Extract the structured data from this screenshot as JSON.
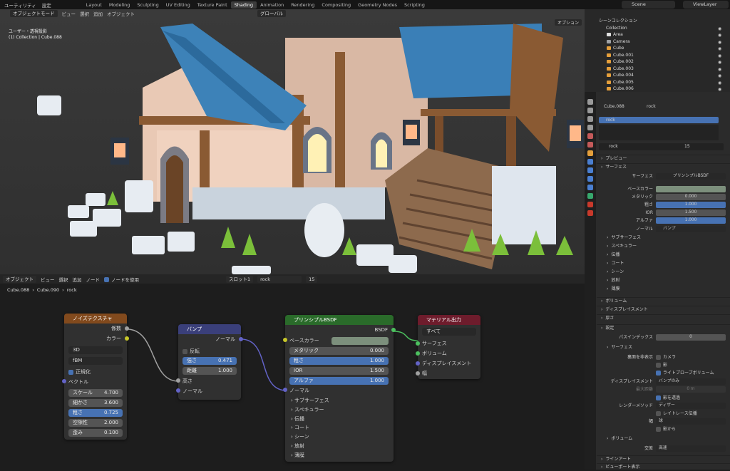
{
  "topbar": {
    "menus": [
      "ユーティリティ",
      "設定"
    ],
    "workspaces": [
      "Layout",
      "Modeling",
      "Sculpting",
      "UV Editing",
      "Texture Paint",
      "Shading",
      "Animation",
      "Rendering",
      "Compositing",
      "Geometry Nodes",
      "Scripting"
    ],
    "active_workspace": "Shading",
    "scene": "Scene",
    "view_layer": "ViewLayer"
  },
  "viewport": {
    "mode": "オブジェクトモード",
    "menus": [
      "ビュー",
      "選択",
      "追加",
      "オブジェクト"
    ],
    "orientation": "グローバル",
    "options": "オプション",
    "info_line1": "ユーザー・透視投影",
    "info_line2": "(1) Collection | Cube.088"
  },
  "node_editor": {
    "editor_type": "オブジェクト",
    "menus": [
      "ビュー",
      "選択",
      "追加",
      "ノード"
    ],
    "use_nodes_label": "ノードを使用",
    "slot": "スロット1",
    "material": "rock",
    "users": "15",
    "breadcrumb": [
      "Cube.088",
      "Cube.090",
      "rock"
    ],
    "noise": {
      "title": "ノイズテクスチャ",
      "out_fac": "係数",
      "out_color": "カラー",
      "dim": "3D",
      "type": "fBM",
      "normalize": "正規化",
      "vector": "ベクトル",
      "scale_l": "スケール",
      "scale_v": "4.700",
      "detail_l": "細かさ",
      "detail_v": "3.600",
      "rough_l": "粗さ",
      "rough_v": "0.725",
      "lac_l": "空隙性",
      "lac_v": "2.000",
      "dist_l": "歪み",
      "dist_v": "0.100"
    },
    "bump": {
      "title": "バンプ",
      "out_normal": "ノーマル",
      "invert": "反転",
      "strength_l": "強さ",
      "strength_v": "0.471",
      "distance_l": "距離",
      "distance_v": "1.000",
      "height": "高さ",
      "normal": "ノーマル"
    },
    "bsdf": {
      "title": "プリンシプルBSDF",
      "out": "BSDF",
      "base_color": "ベースカラー",
      "metallic_l": "メタリック",
      "metallic_v": "0.000",
      "rough_l": "粗さ",
      "rough_v": "1.000",
      "ior_l": "IOR",
      "ior_v": "1.500",
      "alpha_l": "アルファ",
      "alpha_v": "1.000",
      "normal": "ノーマル",
      "panels": [
        "サブサーフェス",
        "スペキュラー",
        "伝播",
        "コート",
        "シーン",
        "放射",
        "薄膜"
      ]
    },
    "output": {
      "title": "マテリアル出力",
      "target": "すべて",
      "inputs": [
        "サーフェス",
        "ボリューム",
        "ディスプレイスメント",
        "幅"
      ]
    }
  },
  "outliner": {
    "root": "シーンコレクション",
    "collection": "Collection",
    "items": [
      "Area",
      "Camera",
      "Cube",
      "Cube.001",
      "Cube.002",
      "Cube.003",
      "Cube.004",
      "Cube.005",
      "Cube.006"
    ]
  },
  "properties": {
    "object": "Cube.088",
    "material_name": "rock",
    "slot_name": "rock",
    "users": "15",
    "preview": "プレビュー",
    "surface": "サーフェス",
    "surface_shader_l": "サーフェス",
    "surface_shader_v": "プリンシプルBSDF",
    "base_color_l": "ベースカラー",
    "metallic_l": "メタリック",
    "metallic_v": "0.000",
    "rough_l": "粗さ",
    "rough_v": "1.000",
    "ior_l": "IOR",
    "ior_v": "1.500",
    "alpha_l": "アルファ",
    "alpha_v": "1.000",
    "normal_l": "ノーマル",
    "normal_v": "バンプ",
    "subpanels": [
      "サブサーフェス",
      "スペキュラー",
      "伝播",
      "コート",
      "シーン",
      "放射",
      "薄膜"
    ],
    "volume": "ボリューム",
    "displacement": "ディスプレイスメント",
    "thickness": "厚さ",
    "settings": "設定",
    "pass_index_l": "パスインデックス",
    "pass_index_v": "0",
    "surface_sub": "サーフェス",
    "backface_l": "裏面を非表示",
    "camera": "カメラ",
    "shadow": "影",
    "light_probe": "ライトプローブボリューム",
    "displacement_l": "ディスプレイスメント",
    "displacement_v": "バンプのみ",
    "max_dist_l": "最大距離",
    "max_dist_v": "0 m",
    "transparent_shadow": "影を透過",
    "render_method_l": "レンダーメソッド",
    "render_method_v": "ディザー",
    "raytrace": "レイトレース伝播",
    "thickness_l": "幅",
    "thickness_v": "球",
    "from_shadow": "影から",
    "volume2": "ボリューム",
    "intersection_l": "交差",
    "intersection_v": "高速",
    "lineart": "ラインアート",
    "viewport_display": "ビューポート表示"
  }
}
